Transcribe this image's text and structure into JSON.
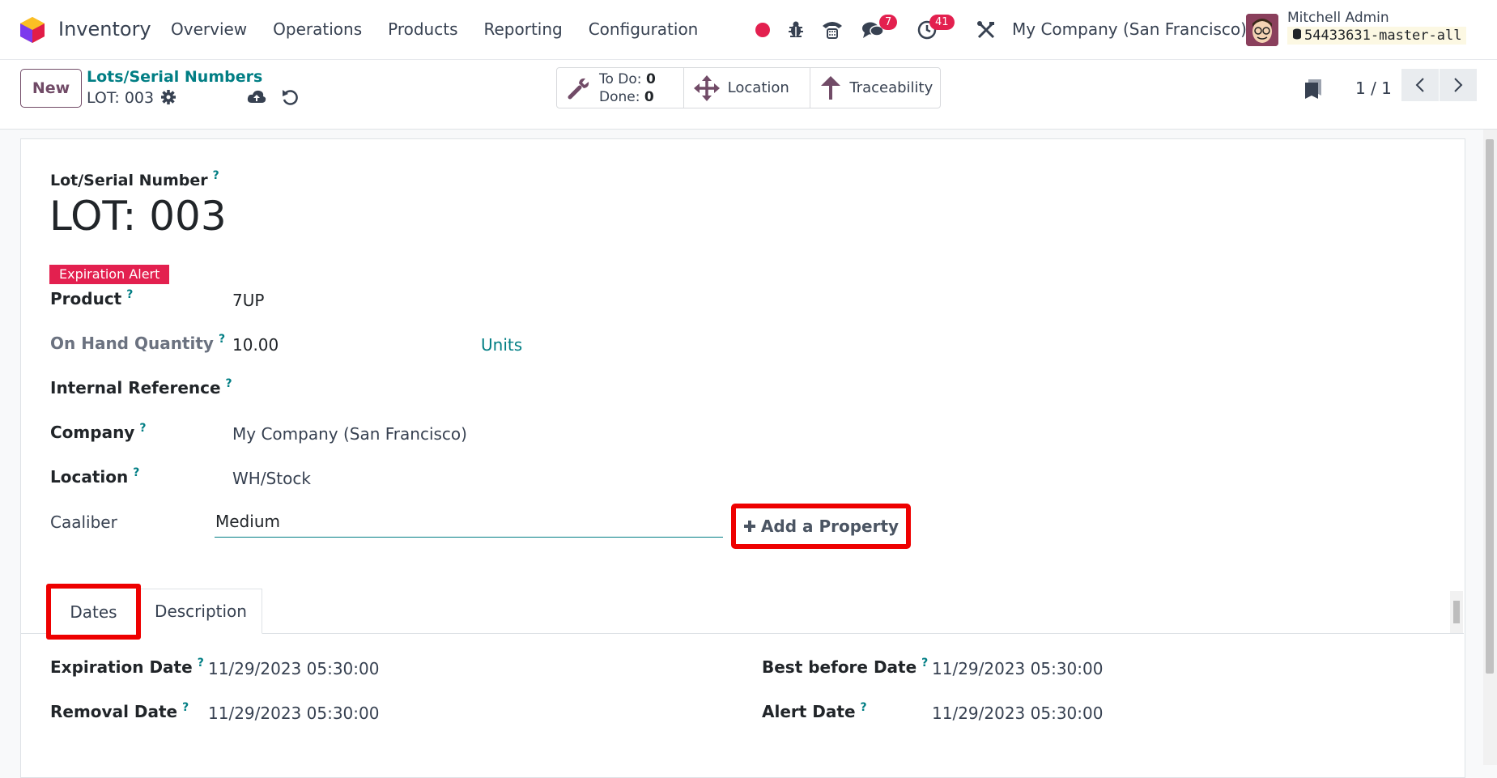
{
  "navbar": {
    "app_name": "Inventory",
    "menu": [
      "Overview",
      "Operations",
      "Products",
      "Reporting",
      "Configuration"
    ],
    "chat_badge": "7",
    "activity_badge": "41",
    "company": "My Company (San Francisco)",
    "user_name": "Mitchell Admin",
    "db_name": "54433631-master-all"
  },
  "control": {
    "new_label": "New",
    "breadcrumb_parent": "Lots/Serial Numbers",
    "record_name": "LOT: 003",
    "todo_label": "To Do:",
    "todo_value": "0",
    "done_label": "Done:",
    "done_value": "0",
    "location_label": "Location",
    "traceability_label": "Traceability",
    "pager": "1 / 1"
  },
  "form": {
    "lot_label": "Lot/Serial Number",
    "lot_value": "LOT: 003",
    "expiration_badge": "Expiration Alert",
    "product_label": "Product",
    "product_value": "7UP",
    "onhand_label": "On Hand Quantity",
    "onhand_value": "10.00",
    "onhand_uom": "Units",
    "internal_ref_label": "Internal Reference",
    "company_label": "Company",
    "company_value": "My Company (San Francisco)",
    "location_label": "Location",
    "location_value": "WH/Stock",
    "caaliber_label": "Caaliber",
    "caaliber_value": "Medium",
    "add_property_label": "Add a Property",
    "help_mark": "?"
  },
  "tabs": {
    "dates_label": "Dates",
    "description_label": "Description"
  },
  "dates": {
    "expiration_label": "Expiration Date",
    "expiration_value": "11/29/2023 05:30:00",
    "removal_label": "Removal Date",
    "removal_value": "11/29/2023 05:30:00",
    "best_before_label": "Best before Date",
    "best_before_value": "11/29/2023 05:30:00",
    "alert_label": "Alert Date",
    "alert_value": "11/29/2023 05:30:00"
  },
  "colors": {
    "brand": "#714b67",
    "link": "#017e84",
    "badge": "#e3204f",
    "highlight": "#ee0000"
  }
}
